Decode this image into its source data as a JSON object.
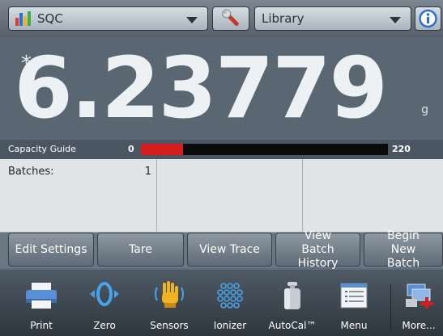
{
  "header": {
    "app_selector": {
      "label": "SQC",
      "icon": "bar-chart-icon"
    },
    "settings_button": {
      "icon": "wrench-icon"
    },
    "library_selector": {
      "label": "Library"
    },
    "info_button": {
      "icon": "info-icon"
    }
  },
  "display": {
    "stability_indicator": "*",
    "weight": "6.23779",
    "unit": "g"
  },
  "capacity_guide": {
    "label": "Capacity Guide",
    "min": "0",
    "max": "220",
    "fill_fraction": 0.17,
    "fill_color": "#d51d1d"
  },
  "info_panel": {
    "batches_label": "Batches:",
    "batches_value": "1"
  },
  "softkeys": [
    {
      "label": "Edit Settings"
    },
    {
      "label": "Tare"
    },
    {
      "label": "View Trace"
    },
    {
      "label": "View Batch History"
    },
    {
      "label": "Begin New Batch"
    }
  ],
  "toolbar": [
    {
      "label": "Print",
      "icon": "printer-icon"
    },
    {
      "label": "Zero",
      "icon": "zero-icon"
    },
    {
      "label": "Sensors",
      "icon": "hand-sensor-icon"
    },
    {
      "label": "Ionizer",
      "icon": "ionizer-icon"
    },
    {
      "label": "AutoCal™",
      "icon": "calibration-weight-icon"
    },
    {
      "label": "Menu",
      "icon": "menu-icon"
    },
    {
      "label": "More...",
      "icon": "more-icon"
    }
  ]
}
